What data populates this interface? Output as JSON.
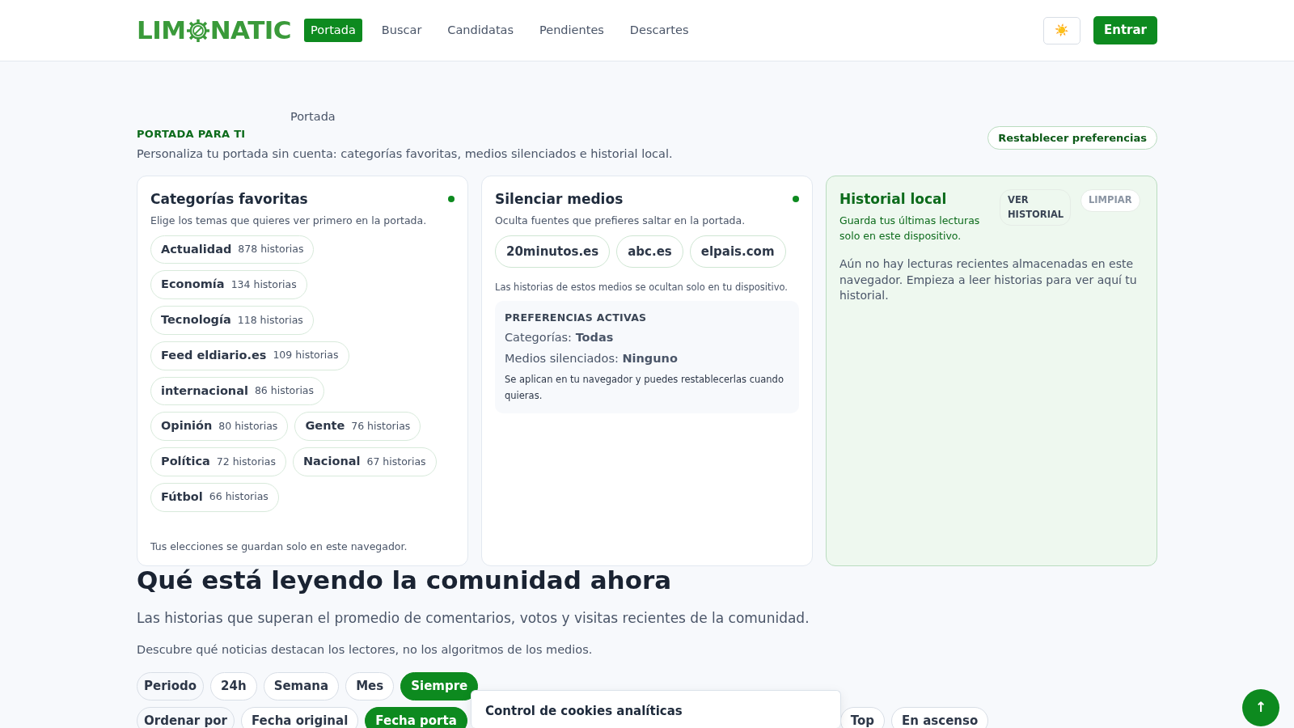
{
  "navbar": {
    "logo_left": "LIM",
    "logo_right": "NATIC",
    "links": [
      {
        "label": "Portada",
        "selected": true
      },
      {
        "label": "Buscar",
        "selected": false
      },
      {
        "label": "Candidatas",
        "selected": false
      },
      {
        "label": "Pendientes",
        "selected": false
      },
      {
        "label": "Descartes",
        "selected": false
      }
    ],
    "theme_button": "☀️",
    "login_button": "Entrar"
  },
  "breadcrumb": "Portada",
  "header": {
    "eyebrow": "PORTADA PARA TI",
    "description": "Personaliza tu portada sin cuenta: categorías favoritas, medios silenciados e historial local.",
    "reset_button": "Restablecer preferencias"
  },
  "favorites": {
    "title": "Categorías favoritas",
    "subtitle": "Elige los temas que quieres ver primero en la portada.",
    "categories": [
      {
        "name": "Actualidad",
        "count": "878 historias",
        "selected": false
      },
      {
        "name": "Economía",
        "count": "134 historias",
        "selected": false
      },
      {
        "name": "Tecnología",
        "count": "118 historias",
        "selected": false
      },
      {
        "name": "Feed eldiario.es",
        "count": "109 historias",
        "selected": false
      },
      {
        "name": "internacional",
        "count": "86 historias",
        "selected": false
      },
      {
        "name": "Opinión",
        "count": "80 historias",
        "selected": false
      },
      {
        "name": "Gente",
        "count": "76 historias",
        "selected": false
      },
      {
        "name": "Política",
        "count": "72 historias",
        "selected": false
      },
      {
        "name": "Nacional",
        "count": "67 historias",
        "selected": false
      },
      {
        "name": "Fútbol",
        "count": "66 historias",
        "selected": false
      }
    ],
    "footer": "Tus elecciones se guardan solo en este navegador."
  },
  "mute": {
    "title": "Silenciar medios",
    "subtitle": "Oculta fuentes que prefieres saltar en la portada.",
    "sources": [
      {
        "name": "20minutos.es",
        "selected": false
      },
      {
        "name": "abc.es",
        "selected": false
      },
      {
        "name": "elpais.com",
        "selected": false
      }
    ],
    "note": "Las historias de estos medios se ocultan solo en tu dispositivo.",
    "active": {
      "title": "PREFERENCIAS ACTIVAS",
      "lines": [
        "Categorías: **Todas**",
        "Medios silenciados: **Ninguno**"
      ],
      "note": "Se aplican en tu navegador y puedes restablecerlas cuando quieras."
    }
  },
  "history": {
    "title": "Historial local",
    "subtitle": "Guarda tus últimas lecturas solo en este dispositivo.",
    "view_button": "VER HISTORIAL",
    "clear_button": "LIMPIAR",
    "empty": "Aún no hay lecturas recientes almacenadas en este navegador. Empieza a leer historias para ver aquí tu historial."
  },
  "community": {
    "title": "Qué está leyendo la comunidad ahora",
    "lead": "Las historias que superan el promedio de comentarios, votos y visitas recientes de la comunidad.",
    "text": "Descubre qué noticias destacan los lectores, no los algoritmos de los medios.",
    "period": [
      {
        "label": "Periodo",
        "kind": "label",
        "selected": false
      },
      {
        "label": "24h",
        "kind": "option",
        "selected": false
      },
      {
        "label": "Semana",
        "kind": "option",
        "selected": false
      },
      {
        "label": "Mes",
        "kind": "option",
        "selected": false
      },
      {
        "label": "Siempre",
        "kind": "option",
        "selected": true
      }
    ],
    "sort": [
      {
        "label": "Ordenar por",
        "kind": "label",
        "selected": false
      },
      {
        "label": "Fecha original",
        "kind": "option",
        "selected": false
      },
      {
        "label": "Fecha porta",
        "kind": "option",
        "selected": true
      }
    ],
    "sort_right": [
      {
        "label": "Top",
        "selected": false
      },
      {
        "label": "En ascenso",
        "selected": false
      }
    ]
  },
  "cookie_popup": {
    "title": "Control de cookies analíticas"
  },
  "scroll_top_button": "↑"
}
